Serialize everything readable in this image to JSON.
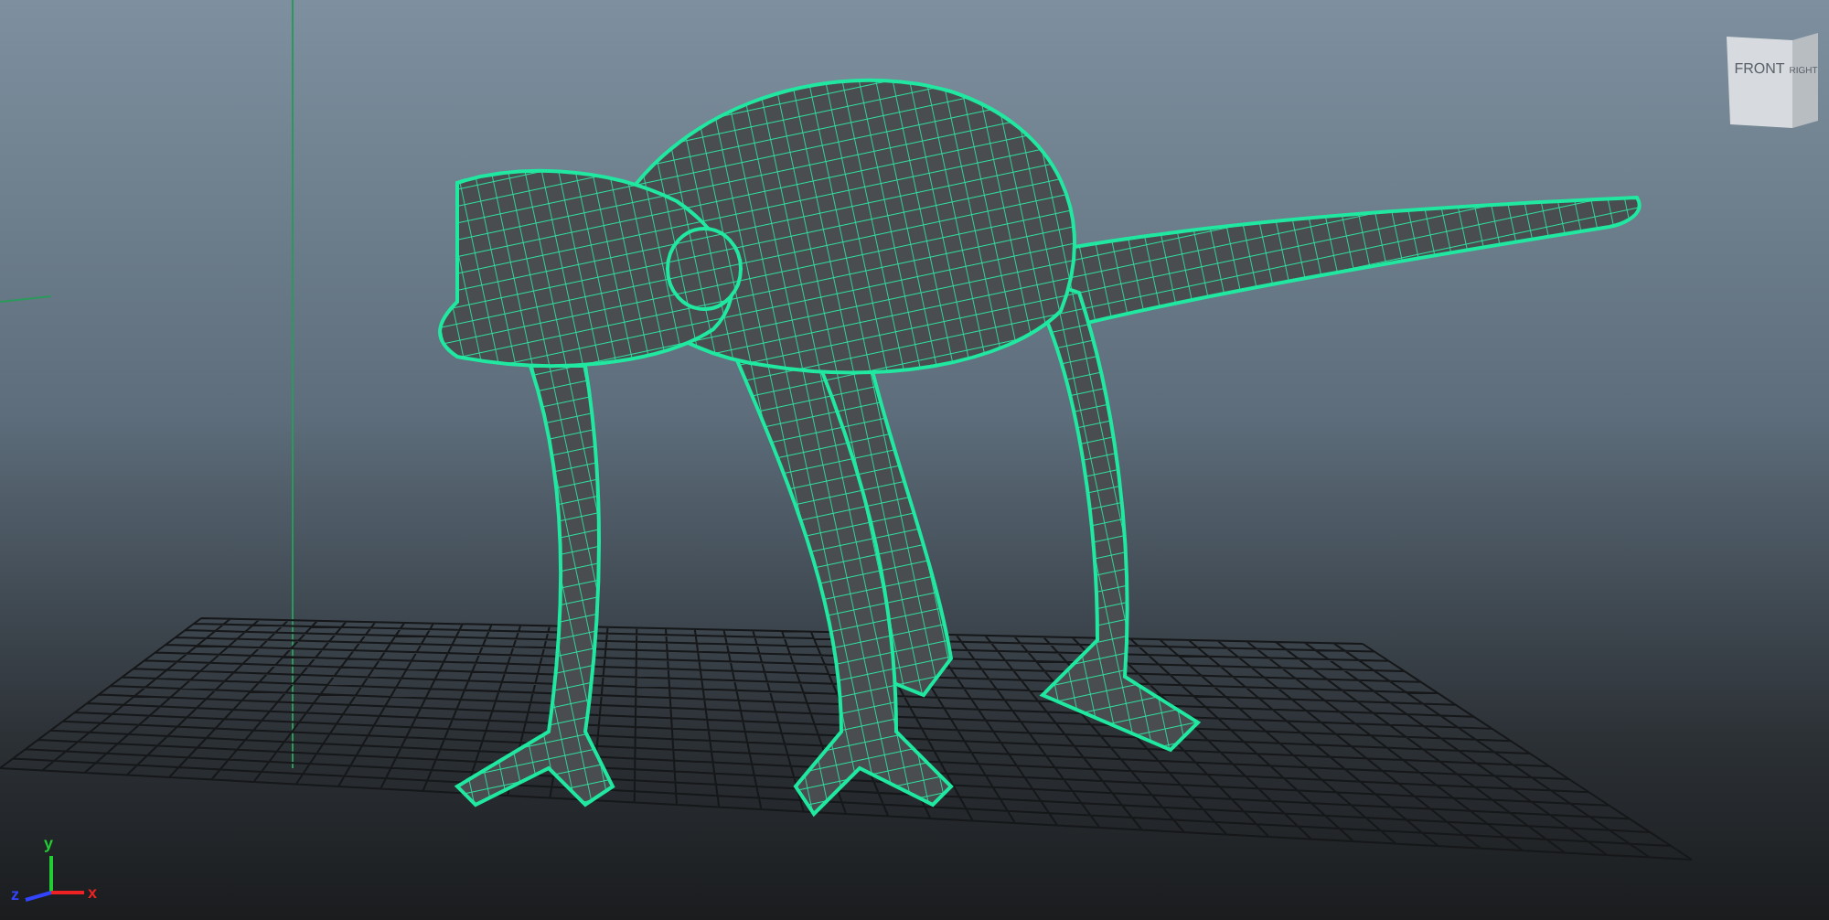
{
  "view_cube": {
    "faces": [
      "FRONT",
      "RIGHT"
    ]
  },
  "axis_indicator": {
    "axes": [
      {
        "label": "y",
        "color": "#22cc33"
      },
      {
        "label": "z",
        "color": "#3344ff"
      },
      {
        "label": "x",
        "color": "#ee2222"
      }
    ]
  }
}
